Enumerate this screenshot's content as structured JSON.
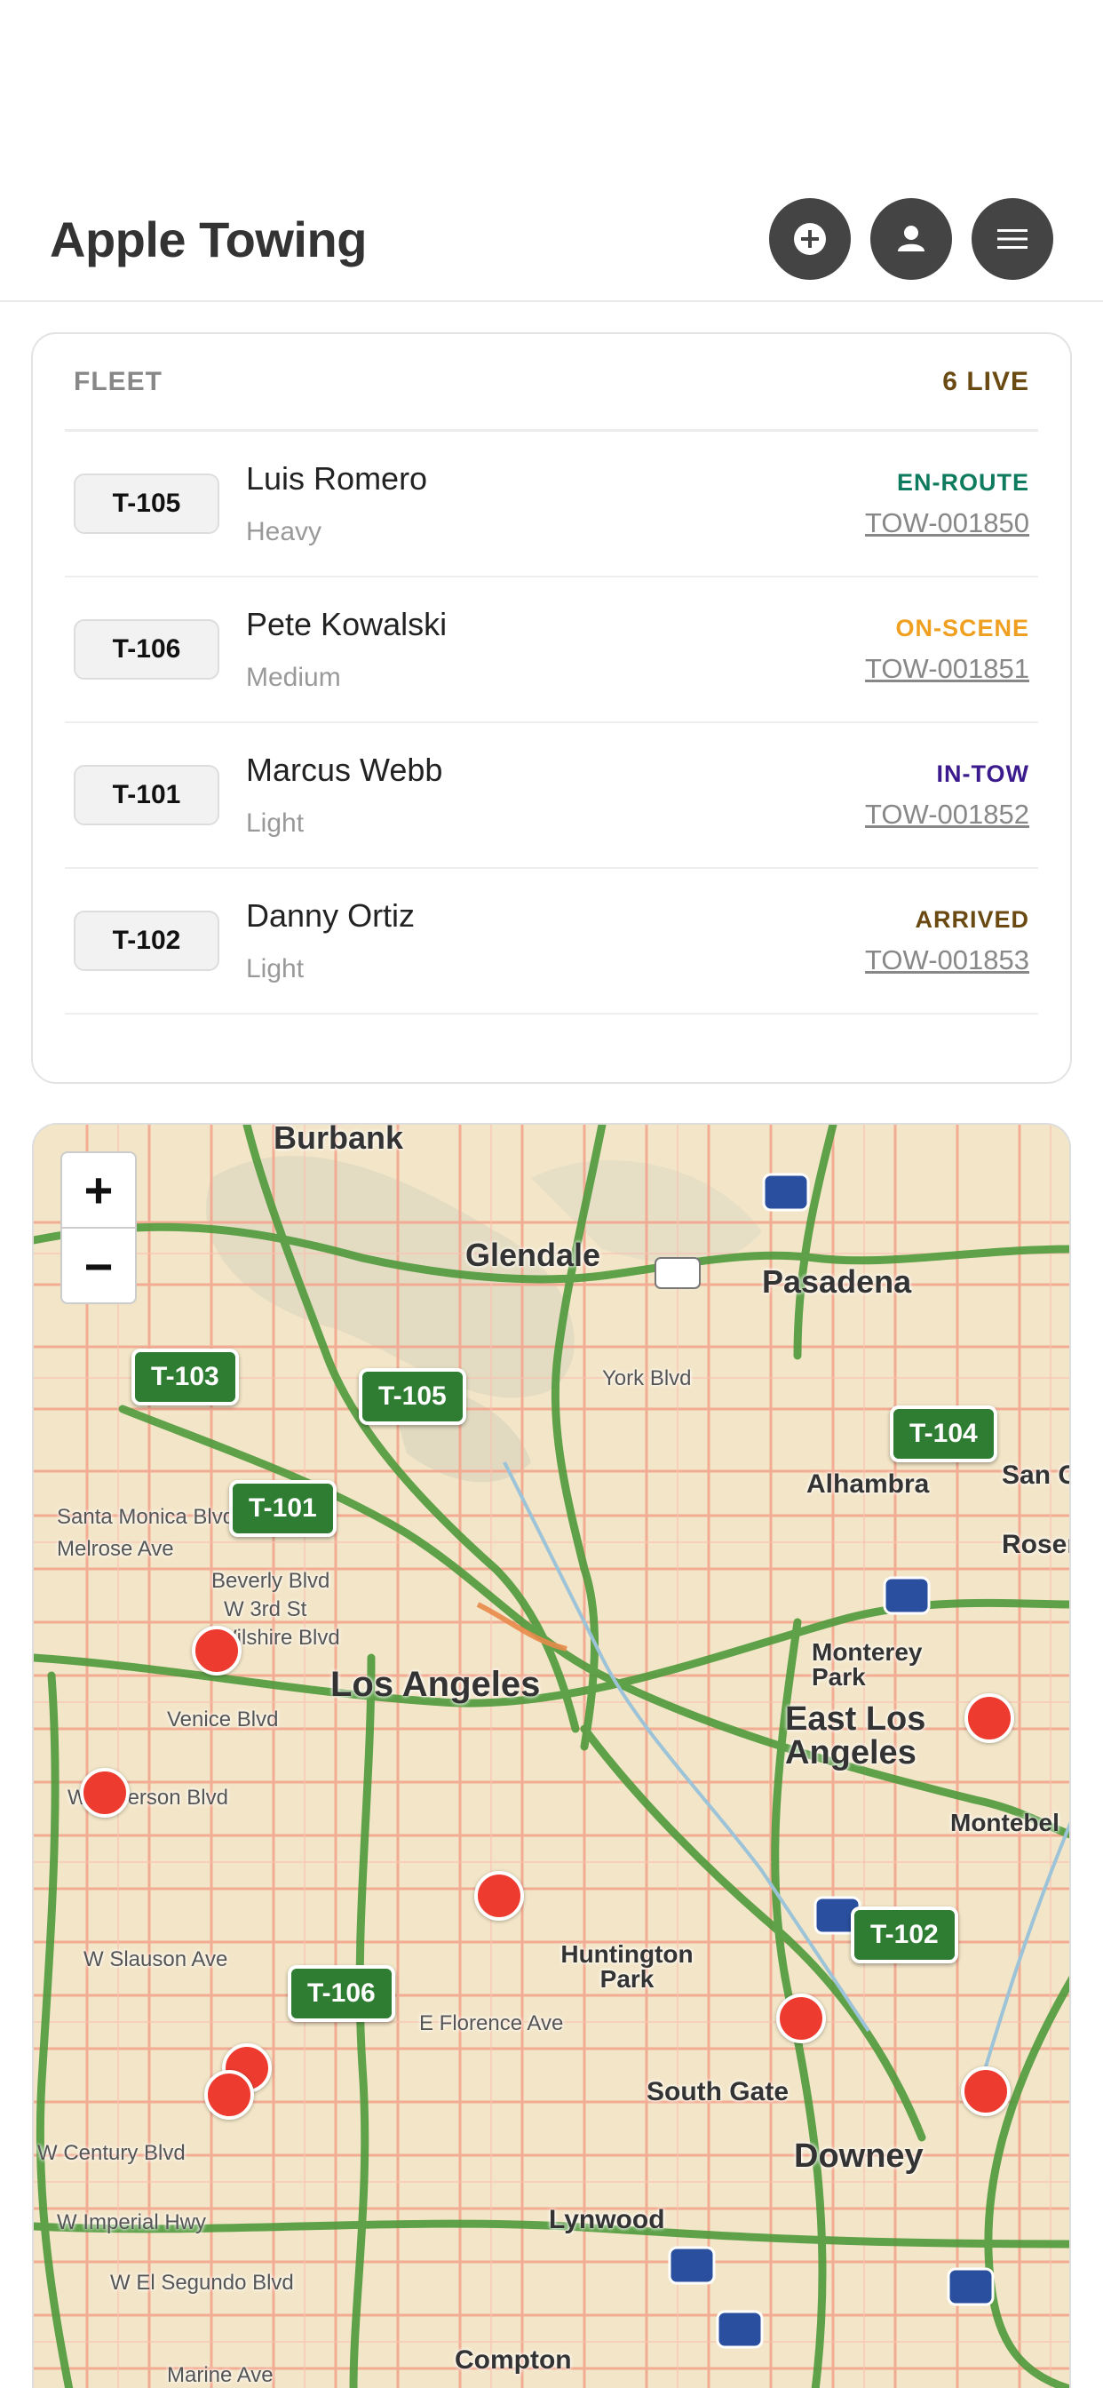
{
  "header": {
    "title": "Apple Towing",
    "actions": [
      "add-icon",
      "user-icon",
      "menu-icon"
    ]
  },
  "fleet": {
    "title": "FLEET",
    "live_count": "6 LIVE",
    "rows": [
      {
        "truck": "T-105",
        "driver": "Luis Romero",
        "class": "Heavy",
        "status": "EN-ROUTE",
        "status_color": "#0e7a5e",
        "job": "TOW-001850"
      },
      {
        "truck": "T-106",
        "driver": "Pete Kowalski",
        "class": "Medium",
        "status": "ON-SCENE",
        "status_color": "#f0a020",
        "job": "TOW-001851"
      },
      {
        "truck": "T-101",
        "driver": "Marcus Webb",
        "class": "Light",
        "status": "IN-TOW",
        "status_color": "#3a1a8c",
        "job": "TOW-001852"
      },
      {
        "truck": "T-102",
        "driver": "Danny Ortiz",
        "class": "Light",
        "status": "ARRIVED",
        "status_color": "#6a4a12",
        "job": "TOW-001853"
      }
    ]
  },
  "map": {
    "zoom_in": "+",
    "zoom_out": "−",
    "trucks": [
      "T-103",
      "T-105",
      "T-104",
      "T-101",
      "T-106",
      "T-102"
    ],
    "labels": {
      "burbank": "Burbank",
      "glendale": "Glendale",
      "pasadena": "Pasadena",
      "alhambra": "Alhambra",
      "los_angeles": "Los Angeles",
      "east_la": "East Los Angeles",
      "monterey_park": "Monterey Park",
      "huntington_park": "Huntington Park",
      "south_gate": "South Gate",
      "downey": "Downey",
      "lynwood": "Lynwood",
      "compton": "Compton",
      "montebello": "Montebel",
      "wilshire": "Wilshire Blvd",
      "venice": "Venice Blvd",
      "slauson": "W Slauson Ave",
      "century": "W Century Blvd",
      "florence": "E Florence Ave",
      "imperial": "W Imperial Hwy",
      "elsegundo": "W El Segundo Blvd",
      "santa_monica": "Santa Monica Blvd",
      "melrose": "Melrose Ave",
      "beverly": "Beverly Blvd",
      "third": "W 3rd St",
      "jefferson": "W Jefferson Blvd",
      "york": "York Blvd",
      "marine": "Marine Ave",
      "rosemead": "Rosem",
      "san_g": "San G"
    },
    "colors": {
      "truck": "#2e7d32",
      "job": "#ee3b2f",
      "freeway": "#4a9a3a",
      "street": "#f2a08a"
    }
  }
}
